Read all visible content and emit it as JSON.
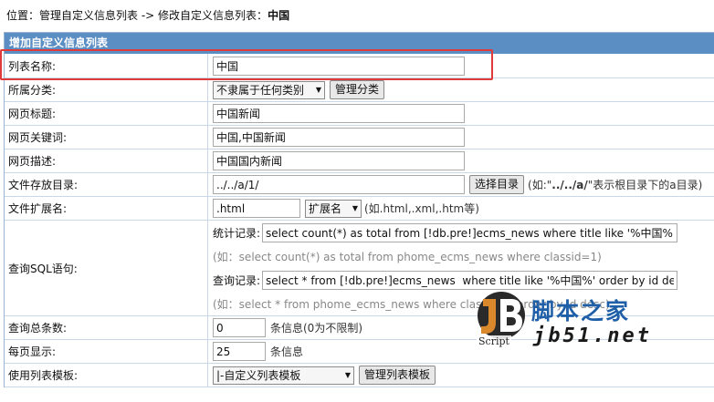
{
  "breadcrumb": {
    "prefix": "位置：",
    "link1": "管理自定义信息列表",
    "sep": " -> ",
    "link2": "修改自定义信息列表：",
    "current": "中国"
  },
  "panel": {
    "title": "增加自定义信息列表"
  },
  "form": {
    "list_name": {
      "label": "列表名称:",
      "value": "中国"
    },
    "category": {
      "label": "所属分类:",
      "selected": "不隶属于任何类别",
      "manage_btn": "管理分类"
    },
    "page_title": {
      "label": "网页标题:",
      "value": "中国新闻"
    },
    "keywords": {
      "label": "网页关键词:",
      "value": "中国,中国新闻"
    },
    "description": {
      "label": "网页描述:",
      "value": "中国国内新闻"
    },
    "directory": {
      "label": "文件存放目录:",
      "value": "../../a/1/",
      "choose_btn": "选择目录",
      "hint_prefix": "(如:\"",
      "hint_bold": "../../a/",
      "hint_suffix": "\"表示根目录下的a目录)"
    },
    "extension": {
      "label": "文件扩展名:",
      "value": ".html",
      "select": "扩展名",
      "hint": "(如.html,.xml,.htm等)"
    },
    "sql": {
      "label": "查询SQL语句:",
      "count_label": "统计记录:",
      "count_value": "select count(*) as total from [!db.pre!]ecms_news where title like '%中国%'",
      "count_hint": "(如：select count(*) as total from phome_ecms_news where classid=1)",
      "query_label": "查询记录:",
      "query_value": "select * from [!db.pre!]ecms_news  where title like '%中国%' order by id desc",
      "query_hint": "(如：select * from phome_ecms_news where classid=1 order by id desc)"
    },
    "total": {
      "label": "查询总条数:",
      "value": "0",
      "hint": "条信息(0为不限制)"
    },
    "per_page": {
      "label": "每页显示:",
      "value": "25",
      "hint": "条信息"
    },
    "template": {
      "label": "使用列表模板:",
      "selected": "|-自定义列表模板",
      "manage_btn": "管理列表模板"
    }
  },
  "watermark": {
    "logo_text": "Script",
    "cn_text": "脚本之家",
    "url_text": "jb51.net"
  },
  "colors": {
    "header_bg": "#5b8fc4",
    "highlight": "#e03b3b",
    "border": "#c9d8e8"
  }
}
